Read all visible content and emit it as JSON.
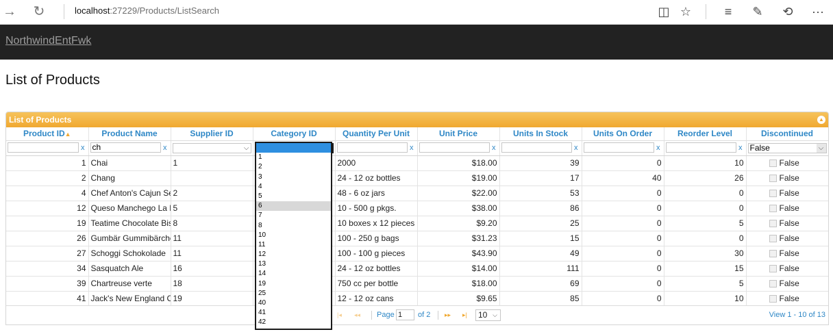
{
  "browser": {
    "url_host": "localhost",
    "url_rest": ":27229/Products/ListSearch",
    "icons": [
      "back-arrow-icon",
      "refresh-icon",
      "reading-view-icon",
      "favorite-star-icon",
      "hub-icon",
      "web-note-icon",
      "share-icon",
      "more-icon"
    ]
  },
  "site": {
    "brand": "NorthwindEntFwk"
  },
  "page": {
    "title": "List of Products"
  },
  "grid": {
    "caption": "List of Products",
    "columns": [
      "Product ID",
      "Product Name",
      "Supplier ID",
      "Category ID",
      "Quantity Per Unit",
      "Unit Price",
      "Units In Stock",
      "Units On Order",
      "Reorder Level",
      "Discontinued"
    ],
    "sorted_column": "Product ID",
    "filters": {
      "product_id": "",
      "product_name": "ch",
      "supplier_id": "",
      "category_id": "",
      "quantity_per_unit": "",
      "unit_price": "",
      "units_in_stock": "",
      "units_on_order": "",
      "reorder_level": "",
      "discontinued": "False",
      "clear": "x"
    },
    "rows": [
      {
        "id": "1",
        "name": "Chai",
        "supplier": "1",
        "qty": "2000",
        "price": "$18.00",
        "stock": "39",
        "order": "0",
        "reorder": "10",
        "disc": "False"
      },
      {
        "id": "2",
        "name": "Chang",
        "supplier": "",
        "qty": "24 - 12 oz bottles",
        "price": "$19.00",
        "stock": "17",
        "order": "40",
        "reorder": "26",
        "disc": "False"
      },
      {
        "id": "4",
        "name": "Chef Anton's Cajun Seas",
        "supplier": "2",
        "qty": "48 - 6 oz jars",
        "price": "$22.00",
        "stock": "53",
        "order": "0",
        "reorder": "0",
        "disc": "False"
      },
      {
        "id": "12",
        "name": "Queso Manchego La Past",
        "supplier": "5",
        "qty": "10 - 500 g pkgs.",
        "price": "$38.00",
        "stock": "86",
        "order": "0",
        "reorder": "0",
        "disc": "False"
      },
      {
        "id": "19",
        "name": "Teatime Chocolate Biscu",
        "supplier": "8",
        "qty": "10 boxes x 12 pieces",
        "price": "$9.20",
        "stock": "25",
        "order": "0",
        "reorder": "5",
        "disc": "False"
      },
      {
        "id": "26",
        "name": "Gumbär Gummibärchen",
        "supplier": "11",
        "qty": "100 - 250 g bags",
        "price": "$31.23",
        "stock": "15",
        "order": "0",
        "reorder": "0",
        "disc": "False"
      },
      {
        "id": "27",
        "name": "Schoggi Schokolade",
        "supplier": "11",
        "qty": "100 - 100 g pieces",
        "price": "$43.90",
        "stock": "49",
        "order": "0",
        "reorder": "30",
        "disc": "False"
      },
      {
        "id": "34",
        "name": "Sasquatch Ale",
        "supplier": "16",
        "qty": "24 - 12 oz bottles",
        "price": "$14.00",
        "stock": "111",
        "order": "0",
        "reorder": "15",
        "disc": "False"
      },
      {
        "id": "39",
        "name": "Chartreuse verte",
        "supplier": "18",
        "qty": "750 cc per bottle",
        "price": "$18.00",
        "stock": "69",
        "order": "0",
        "reorder": "5",
        "disc": "False"
      },
      {
        "id": "41",
        "name": "Jack's New England Clar",
        "supplier": "19",
        "qty": "12 - 12 oz cans",
        "price": "$9.65",
        "stock": "85",
        "order": "0",
        "reorder": "10",
        "disc": "False"
      }
    ],
    "category_dropdown": {
      "options": [
        "",
        "1",
        "2",
        "3",
        "4",
        "5",
        "6",
        "7",
        "8",
        "10",
        "11",
        "12",
        "13",
        "14",
        "19",
        "25",
        "40",
        "41",
        "42"
      ],
      "highlighted_index": 0,
      "hover_value": "6"
    },
    "pager": {
      "page_label": "Page",
      "page_value": "1",
      "of_label": "of 2",
      "page_size": "10",
      "view_text": "View 1 - 10 of 13"
    }
  }
}
